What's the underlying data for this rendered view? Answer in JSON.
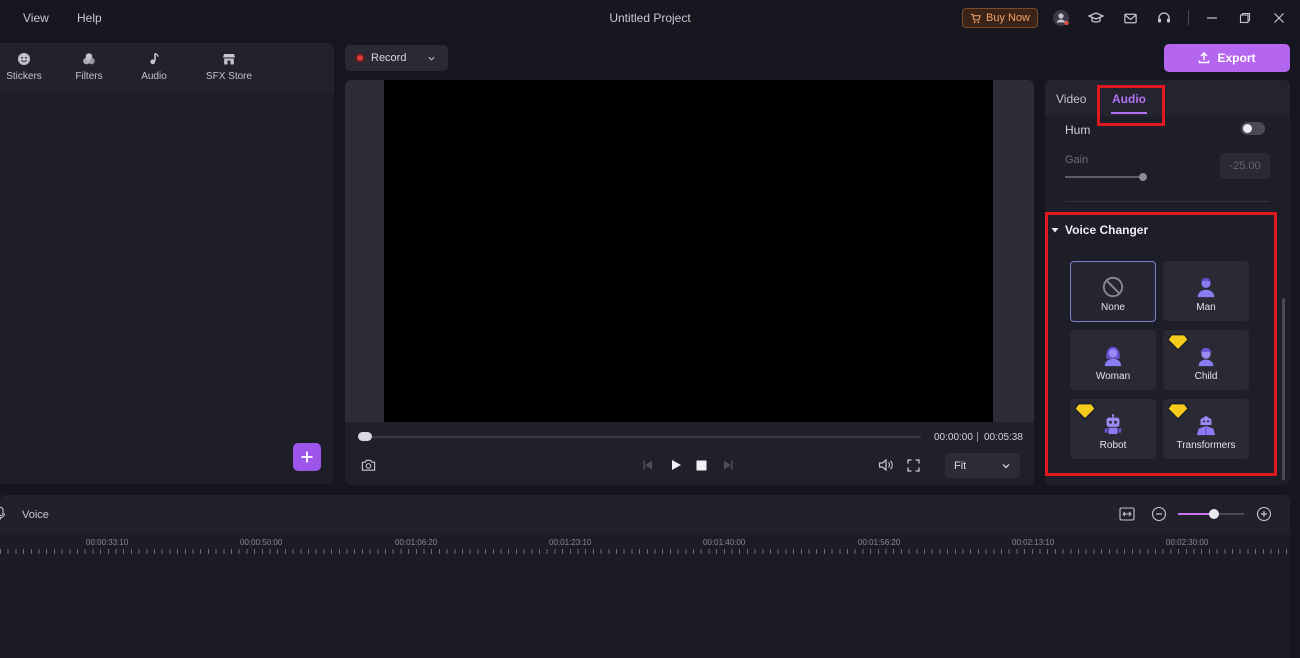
{
  "titlebar": {
    "menu": [
      "View",
      "Help"
    ],
    "title": "Untitled Project",
    "buy_now": "Buy Now"
  },
  "left_panel": {
    "tabs": [
      "Stickers",
      "Filters",
      "Audio",
      "SFX Store"
    ]
  },
  "record": {
    "label": "Record"
  },
  "player": {
    "current_time": "00:00:00",
    "total_time": "00:05:38",
    "fit": "Fit"
  },
  "export": {
    "label": "Export"
  },
  "right_panel": {
    "tabs": {
      "video": "Video",
      "audio": "Audio"
    },
    "hum": {
      "label": "Hum",
      "enabled": false
    },
    "gain": {
      "label": "Gain",
      "value": "-25.00"
    },
    "voice_changer": {
      "title": "Voice Changer",
      "options": [
        {
          "label": "None",
          "selected": true,
          "premium": false
        },
        {
          "label": "Man",
          "selected": false,
          "premium": false
        },
        {
          "label": "Woman",
          "selected": false,
          "premium": false
        },
        {
          "label": "Child",
          "selected": false,
          "premium": true
        },
        {
          "label": "Robot",
          "selected": false,
          "premium": true
        },
        {
          "label": "Transformers",
          "selected": false,
          "premium": true
        }
      ]
    }
  },
  "timeline": {
    "track_label": "Voice",
    "ruler": [
      "00:00:33:10",
      "00:00:50:00",
      "00:01:06:20",
      "00:01:23:10",
      "00:01:40:00",
      "00:01:56:20",
      "00:02:13:10",
      "00:02:30:00"
    ]
  },
  "colors": {
    "accent": "#b466f0",
    "highlight": "#e0181f",
    "record": "#e03a3a",
    "premium": "#f5cc1c"
  }
}
